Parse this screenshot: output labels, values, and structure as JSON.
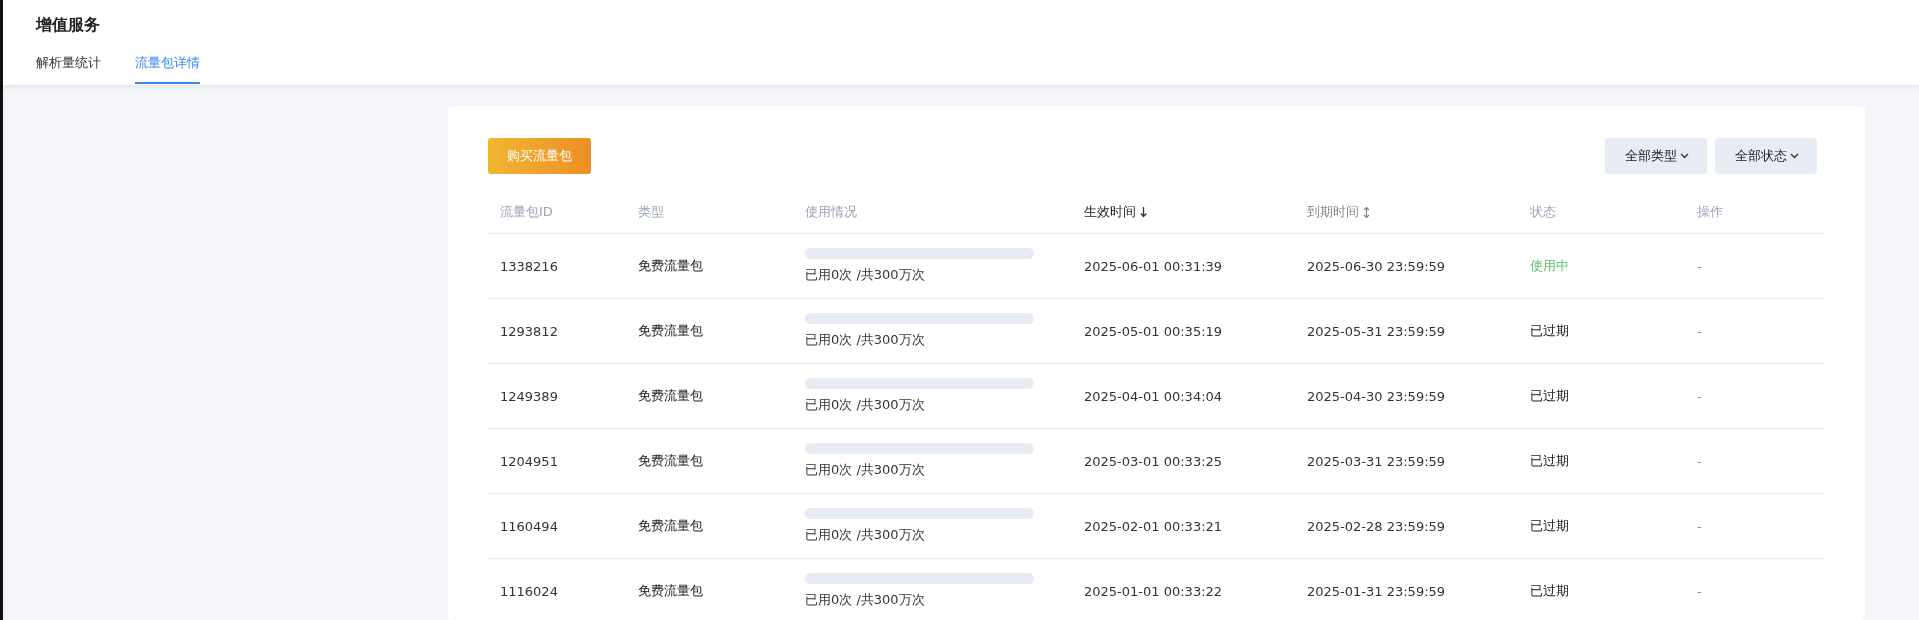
{
  "page": {
    "title": "增值服务"
  },
  "tabs": [
    {
      "label": "解析量统计",
      "selected": false
    },
    {
      "label": "流量包详情",
      "selected": true
    }
  ],
  "toolbar": {
    "buy_button": "购买流量包",
    "filters": [
      "全部类型",
      "全部状态"
    ]
  },
  "table": {
    "columns": [
      {
        "label": "流量包ID"
      },
      {
        "label": "类型"
      },
      {
        "label": "使用情况"
      },
      {
        "label": "生效时间",
        "sortable": true,
        "sorted": true
      },
      {
        "label": "到期时间",
        "sortable": true,
        "sorted": false
      },
      {
        "label": "状态"
      },
      {
        "label": "操作"
      }
    ],
    "rows": [
      {
        "id": "1338216",
        "type": "免费流量包",
        "level": 0,
        "usage": "已用0次 /共300万次",
        "start": "2025-06-01 00:31:39",
        "end": "2025-06-30 23:59:59",
        "status": "使用中",
        "active": true,
        "action": "-"
      },
      {
        "id": "1293812",
        "type": "免费流量包",
        "level": 0,
        "usage": "已用0次 /共300万次",
        "start": "2025-05-01 00:35:19",
        "end": "2025-05-31 23:59:59",
        "status": "已过期",
        "active": false,
        "action": "-"
      },
      {
        "id": "1249389",
        "type": "免费流量包",
        "level": 0,
        "usage": "已用0次 /共300万次",
        "start": "2025-04-01 00:34:04",
        "end": "2025-04-30 23:59:59",
        "status": "已过期",
        "active": false,
        "action": "-"
      },
      {
        "id": "1204951",
        "type": "免费流量包",
        "level": 0,
        "usage": "已用0次 /共300万次",
        "start": "2025-03-01 00:33:25",
        "end": "2025-03-31 23:59:59",
        "status": "已过期",
        "active": false,
        "action": "-"
      },
      {
        "id": "1160494",
        "type": "免费流量包",
        "level": 0,
        "usage": "已用0次 /共300万次",
        "start": "2025-02-01 00:33:21",
        "end": "2025-02-28 23:59:59",
        "status": "已过期",
        "active": false,
        "action": "-"
      },
      {
        "id": "1116024",
        "type": "免费流量包",
        "level": 0,
        "usage": "已用0次 /共300万次",
        "start": "2025-01-01 00:33:22",
        "end": "2025-01-31 23:59:59",
        "status": "已过期",
        "active": false,
        "action": "-"
      }
    ]
  }
}
